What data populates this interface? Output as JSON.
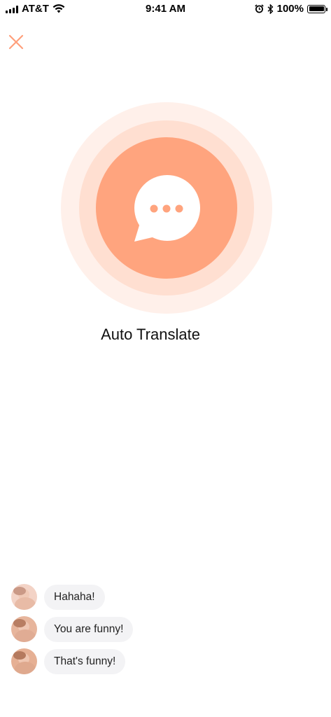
{
  "status_bar": {
    "carrier": "AT&T",
    "time": "9:41 AM",
    "battery_percent": "100%",
    "icons": [
      "signal-bars-icon",
      "wifi-icon",
      "alarm-icon",
      "bluetooth-icon",
      "battery-icon"
    ]
  },
  "close_icon": "close-icon",
  "hero": {
    "icon": "chat-bubble-dots-icon",
    "colors": {
      "outer_ring": "#fff0ea",
      "middle_ring": "#ffdfd1",
      "inner_circle": "#ffa47e",
      "accent": "#ff9f7c"
    }
  },
  "title": "Auto Translate",
  "messages": [
    {
      "text": "Hahaha!"
    },
    {
      "text": "You are funny!"
    },
    {
      "text": "That's funny!"
    }
  ]
}
